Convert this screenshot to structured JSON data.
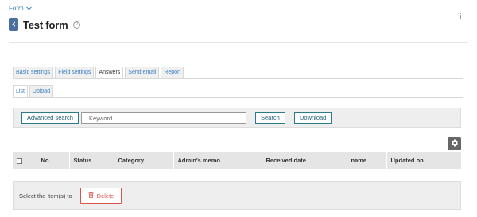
{
  "breadcrumb": {
    "label": "Form"
  },
  "page": {
    "title": "Test form"
  },
  "tabs": [
    {
      "label": "Basic settings",
      "active": false
    },
    {
      "label": "Field settings",
      "active": false
    },
    {
      "label": "Answers",
      "active": true
    },
    {
      "label": "Send email",
      "active": false
    },
    {
      "label": "Report",
      "active": false
    }
  ],
  "subtabs": [
    {
      "label": "List",
      "active": true
    },
    {
      "label": "Upload",
      "active": false
    }
  ],
  "search": {
    "advanced_label": "Advanced search",
    "keyword_placeholder": "Keyword",
    "keyword_value": "",
    "search_label": "Search",
    "download_label": "Download"
  },
  "table": {
    "columns": [
      "No.",
      "Status",
      "Category",
      "Admin's memo",
      "Received date",
      "name",
      "Updated on"
    ],
    "rows": []
  },
  "bulk": {
    "label": "Select the item(s) to",
    "delete_label": "Delete"
  },
  "colors": {
    "link": "#3a7fc1",
    "back_button": "#4a6ea0",
    "outline_button": "#2a7a8a",
    "danger": "#d9534f",
    "header_bg": "#e5e5e5",
    "panel_bg": "#eeeeee"
  },
  "icons": {
    "breadcrumb": "chevron-down-icon",
    "back": "chevron-left-icon",
    "help": "question-circle-icon",
    "menu": "kebab-menu-icon",
    "settings": "gear-icon",
    "delete": "trash-icon"
  }
}
